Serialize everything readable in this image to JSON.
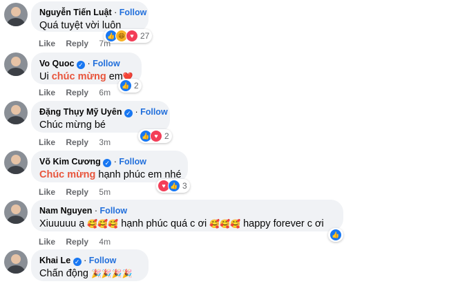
{
  "follow_label": "Follow",
  "actions": {
    "like": "Like",
    "reply": "Reply"
  },
  "comments": [
    {
      "author": "Nguyễn Tiến Luật",
      "verified": false,
      "text": "Quá tuyệt vời luôn",
      "time": "7m",
      "reactions": [
        "like",
        "haha",
        "love"
      ],
      "reaction_count": "27"
    },
    {
      "author": "Vo Quoc",
      "verified": true,
      "text_pre": "Ui ",
      "text_hl": "chúc mừng",
      "text_post": " em",
      "emoji": "❤️",
      "time": "6m",
      "reactions": [
        "like"
      ],
      "reaction_count": "2"
    },
    {
      "author": "Đặng Thụy Mỹ Uyên",
      "verified": true,
      "text": "Chúc mừng bé",
      "time": "3m",
      "reactions": [
        "like",
        "love"
      ],
      "reaction_count": "2"
    },
    {
      "author": "Võ Kim Cương",
      "verified": true,
      "text_hl": "Chúc mừng",
      "text_post": " hạnh phúc em nhé",
      "time": "5m",
      "reactions": [
        "love",
        "like"
      ],
      "reaction_count": "3"
    },
    {
      "author": "Nam Nguyen",
      "verified": false,
      "text_a": "Xiuuuuu ạ ",
      "emoji_a": "🥰🥰🥰",
      "text_b": " hạnh phúc quá c ơi ",
      "emoji_b": "🥰🥰🥰",
      "text_c": " happy forever c ơi",
      "time": "4m",
      "reactions": [
        "like"
      ],
      "reaction_count": ""
    },
    {
      "author": "Khai Le",
      "verified": true,
      "text": "Chấn động ",
      "emoji": "🎉🎉🎉🎉",
      "time": "",
      "reactions": [],
      "reaction_count": ""
    }
  ],
  "colors": {
    "bubble": "#f0f2f5",
    "follow": "#216fdb",
    "highlight": "#e8553c",
    "meta": "#65676b"
  }
}
